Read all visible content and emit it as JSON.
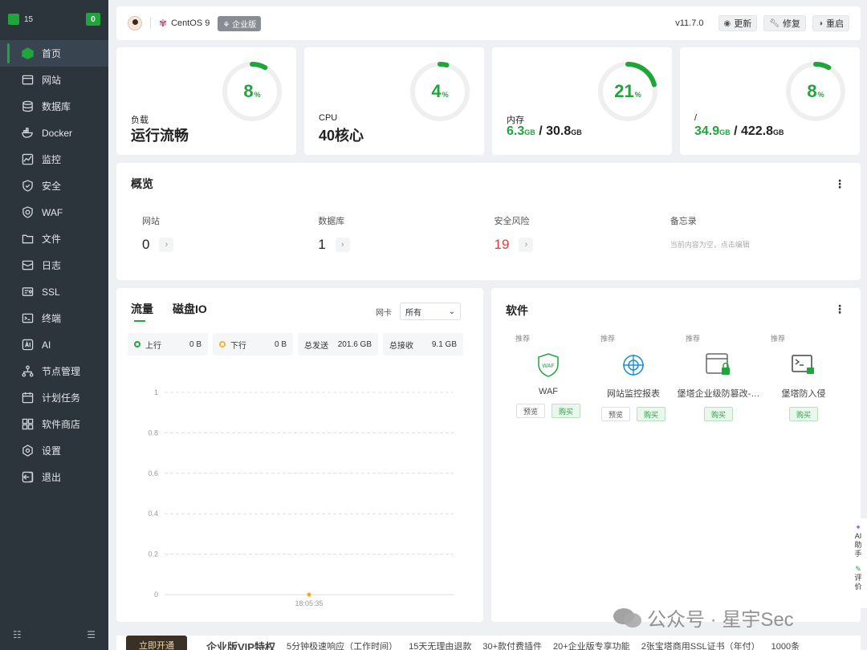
{
  "sidebar": {
    "logo_text": "15",
    "badge": "0",
    "items": [
      {
        "label": "首页",
        "icon": "home-icon"
      },
      {
        "label": "网站",
        "icon": "website-icon"
      },
      {
        "label": "数据库",
        "icon": "database-icon"
      },
      {
        "label": "Docker",
        "icon": "docker-icon"
      },
      {
        "label": "监控",
        "icon": "monitor-icon"
      },
      {
        "label": "安全",
        "icon": "shield-icon"
      },
      {
        "label": "WAF",
        "icon": "waf-icon"
      },
      {
        "label": "文件",
        "icon": "folder-icon"
      },
      {
        "label": "日志",
        "icon": "log-icon"
      },
      {
        "label": "SSL",
        "icon": "ssl-icon"
      },
      {
        "label": "终端",
        "icon": "terminal-icon"
      },
      {
        "label": "AI",
        "icon": "ai-icon"
      },
      {
        "label": "节点管理",
        "icon": "node-icon"
      },
      {
        "label": "计划任务",
        "icon": "calendar-icon"
      },
      {
        "label": "软件商店",
        "icon": "store-icon"
      },
      {
        "label": "设置",
        "icon": "gear-icon"
      },
      {
        "label": "退出",
        "icon": "logout-icon"
      }
    ],
    "bottom_left": "☷",
    "bottom_right": "☰"
  },
  "topbar": {
    "os": "CentOS 9",
    "edition": "企业版",
    "version": "v11.7.0",
    "btn_update": "更新",
    "btn_repair": "修复",
    "btn_restart": "重启"
  },
  "stats": {
    "load": {
      "percent": "8",
      "unit": "%",
      "label": "负载",
      "value": "运行流畅",
      "fraction": 0.08
    },
    "cpu": {
      "percent": "4",
      "unit": "%",
      "label": "CPU",
      "value": "40核心",
      "fraction": 0.04
    },
    "mem": {
      "percent": "21",
      "unit": "%",
      "label": "内存",
      "used": "6.3",
      "used_unit": "GB",
      "total": "30.8",
      "total_unit": "GB",
      "fraction": 0.21
    },
    "disk": {
      "percent": "8",
      "unit": "%",
      "label": "/",
      "used": "34.9",
      "used_unit": "GB",
      "total": "422.8",
      "total_unit": "GB",
      "fraction": 0.08
    }
  },
  "overview": {
    "title": "概览",
    "items": [
      {
        "label": "网站",
        "value": "0"
      },
      {
        "label": "数据库",
        "value": "1"
      },
      {
        "label": "安全风险",
        "value": "19"
      }
    ],
    "memo_label": "备忘录",
    "memo_hint": "当前内容为空，点击编辑"
  },
  "traffic": {
    "tab_flow": "流量",
    "tab_disk": "磁盘IO",
    "nic_label": "网卡",
    "nic_value": "所有",
    "up_label": "上行",
    "up_value": "0 B",
    "down_label": "下行",
    "down_value": "0 B",
    "sent_label": "总发送",
    "sent_value": "201.6 GB",
    "recv_label": "总接收",
    "recv_value": "9.1 GB"
  },
  "chart_data": {
    "type": "line",
    "y_ticks": [
      "1",
      "0.8",
      "0.6",
      "0.4",
      "0.2",
      "0"
    ],
    "ylim": [
      0,
      1
    ],
    "x": [
      "18:05:35"
    ],
    "series": [
      {
        "values": [
          0
        ]
      }
    ],
    "grid": true,
    "colors": {
      "point": "#f5a623",
      "grid": "#dddddd"
    }
  },
  "software": {
    "title": "软件",
    "rec": "推荐",
    "items": [
      {
        "name": "WAF",
        "preview": "预览",
        "buy": "购买"
      },
      {
        "name": "网站监控报表",
        "preview": "预览",
        "buy": "购买"
      },
      {
        "name": "堡塔企业级防篡改-…",
        "buy": "购买"
      },
      {
        "name": "堡塔防入侵",
        "buy": "购买"
      }
    ]
  },
  "float": {
    "ai": "AI",
    "assistant": "助",
    "assistant2": "手",
    "rate": "评",
    "rate2": "价"
  },
  "watermark": "公众号 · 星宇Sec",
  "promo": {
    "open": "立即开通",
    "vip": "企业版VIP特权",
    "items": [
      "5分钟极速响应（工作时间）",
      "15天无理由退款",
      "30+款付费插件",
      "20+企业版专享功能",
      "2张宝塔商用SSL证书（年付）",
      "1000条"
    ]
  },
  "colors": {
    "accent": "#20a53a",
    "sidebar_bg": "#2c343c",
    "risk": "#e23a3a"
  }
}
